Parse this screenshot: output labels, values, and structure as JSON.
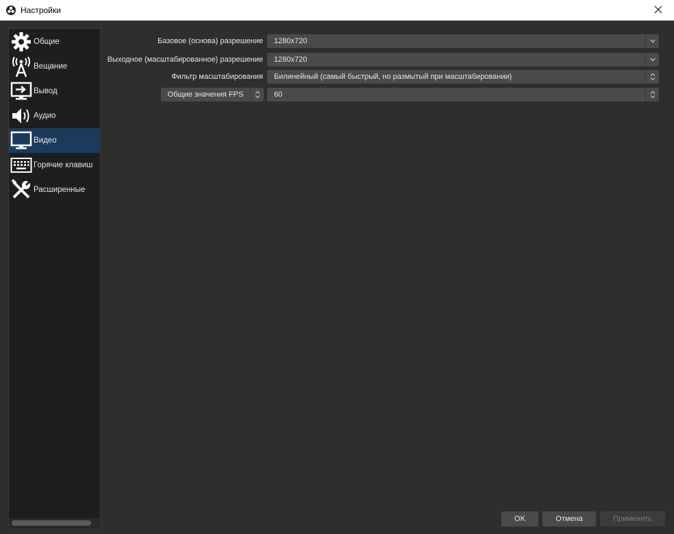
{
  "window": {
    "title": "Настройки"
  },
  "sidebar": {
    "items": [
      {
        "label": "Общие"
      },
      {
        "label": "Вещание"
      },
      {
        "label": "Вывод"
      },
      {
        "label": "Аудио"
      },
      {
        "label": "Видео"
      },
      {
        "label": "Горячие клавиш"
      },
      {
        "label": "Расширенные"
      }
    ],
    "active_index": 4
  },
  "video": {
    "base_resolution": {
      "label": "Базовое (основа) разрешение",
      "value": "1280x720"
    },
    "output_resolution": {
      "label": "Выходное (масштабированное) разрешение",
      "value": "1280x720"
    },
    "scale_filter": {
      "label": "Фильтр масштабирования",
      "value": "Билинейный (самый быстрый, но размытый при масштабировании)"
    },
    "fps": {
      "label": "Общие значения FPS",
      "value": "60"
    }
  },
  "buttons": {
    "ok": "OK",
    "cancel": "Отмена",
    "apply": "Применить"
  },
  "colors": {
    "active_item": "#1b3a5c",
    "background": "#2e2e2e",
    "sidebar": "#1e1e1e",
    "field": "#4a4a4a"
  }
}
